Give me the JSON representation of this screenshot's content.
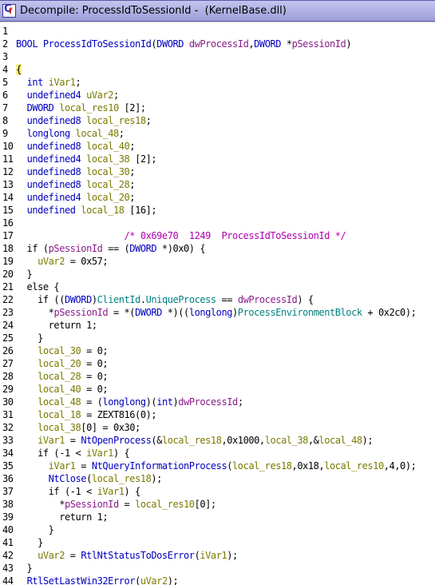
{
  "window": {
    "title": "Decompile: ProcessIdToSessionId -  (KernelBase.dll)"
  },
  "icon": {
    "letter": "C",
    "subscript": "f"
  },
  "colors": {
    "type": "#0000c0",
    "local_var": "#7a7a00",
    "parameter": "#8a1a8a",
    "function": "#0000c0",
    "field": "#008080",
    "comment": "#b000b0",
    "brace_highlight": "#f7f389",
    "titlebar": "#b0b0e4"
  },
  "code_lines": [
    {
      "n": "1",
      "tokens": []
    },
    {
      "n": "2",
      "tokens": [
        {
          "c": "t-type",
          "t": "BOOL"
        },
        {
          "c": "t-plain",
          "t": " "
        },
        {
          "c": "t-fn",
          "t": "ProcessIdToSessionId"
        },
        {
          "c": "t-plain",
          "t": "("
        },
        {
          "c": "t-type",
          "t": "DWORD"
        },
        {
          "c": "t-plain",
          "t": " "
        },
        {
          "c": "t-param",
          "t": "dwProcessId"
        },
        {
          "c": "t-plain",
          "t": ","
        },
        {
          "c": "t-type",
          "t": "DWORD"
        },
        {
          "c": "t-plain",
          "t": " *"
        },
        {
          "c": "t-param",
          "t": "pSessionId"
        },
        {
          "c": "t-plain",
          "t": ")"
        }
      ]
    },
    {
      "n": "3",
      "tokens": []
    },
    {
      "n": "4",
      "tokens": [
        {
          "c": "brace-hl",
          "t": "{"
        }
      ]
    },
    {
      "n": "5",
      "tokens": [
        {
          "c": "t-plain",
          "t": "  "
        },
        {
          "c": "t-type",
          "t": "int"
        },
        {
          "c": "t-plain",
          "t": " "
        },
        {
          "c": "t-var",
          "t": "iVar1"
        },
        {
          "c": "t-plain",
          "t": ";"
        }
      ]
    },
    {
      "n": "6",
      "tokens": [
        {
          "c": "t-plain",
          "t": "  "
        },
        {
          "c": "t-type",
          "t": "undefined4"
        },
        {
          "c": "t-plain",
          "t": " "
        },
        {
          "c": "t-var",
          "t": "uVar2"
        },
        {
          "c": "t-plain",
          "t": ";"
        }
      ]
    },
    {
      "n": "7",
      "tokens": [
        {
          "c": "t-plain",
          "t": "  "
        },
        {
          "c": "t-type",
          "t": "DWORD"
        },
        {
          "c": "t-plain",
          "t": " "
        },
        {
          "c": "t-var",
          "t": "local_res10"
        },
        {
          "c": "t-plain",
          "t": " [2];"
        }
      ]
    },
    {
      "n": "8",
      "tokens": [
        {
          "c": "t-plain",
          "t": "  "
        },
        {
          "c": "t-type",
          "t": "undefined8"
        },
        {
          "c": "t-plain",
          "t": " "
        },
        {
          "c": "t-var",
          "t": "local_res18"
        },
        {
          "c": "t-plain",
          "t": ";"
        }
      ]
    },
    {
      "n": "9",
      "tokens": [
        {
          "c": "t-plain",
          "t": "  "
        },
        {
          "c": "t-type",
          "t": "longlong"
        },
        {
          "c": "t-plain",
          "t": " "
        },
        {
          "c": "t-var",
          "t": "local_48"
        },
        {
          "c": "t-plain",
          "t": ";"
        }
      ]
    },
    {
      "n": "10",
      "tokens": [
        {
          "c": "t-plain",
          "t": "  "
        },
        {
          "c": "t-type",
          "t": "undefined8"
        },
        {
          "c": "t-plain",
          "t": " "
        },
        {
          "c": "t-var",
          "t": "local_40"
        },
        {
          "c": "t-plain",
          "t": ";"
        }
      ]
    },
    {
      "n": "11",
      "tokens": [
        {
          "c": "t-plain",
          "t": "  "
        },
        {
          "c": "t-type",
          "t": "undefined4"
        },
        {
          "c": "t-plain",
          "t": " "
        },
        {
          "c": "t-var",
          "t": "local_38"
        },
        {
          "c": "t-plain",
          "t": " [2];"
        }
      ]
    },
    {
      "n": "12",
      "tokens": [
        {
          "c": "t-plain",
          "t": "  "
        },
        {
          "c": "t-type",
          "t": "undefined8"
        },
        {
          "c": "t-plain",
          "t": " "
        },
        {
          "c": "t-var",
          "t": "local_30"
        },
        {
          "c": "t-plain",
          "t": ";"
        }
      ]
    },
    {
      "n": "13",
      "tokens": [
        {
          "c": "t-plain",
          "t": "  "
        },
        {
          "c": "t-type",
          "t": "undefined8"
        },
        {
          "c": "t-plain",
          "t": " "
        },
        {
          "c": "t-var",
          "t": "local_28"
        },
        {
          "c": "t-plain",
          "t": ";"
        }
      ]
    },
    {
      "n": "14",
      "tokens": [
        {
          "c": "t-plain",
          "t": "  "
        },
        {
          "c": "t-type",
          "t": "undefined4"
        },
        {
          "c": "t-plain",
          "t": " "
        },
        {
          "c": "t-var",
          "t": "local_20"
        },
        {
          "c": "t-plain",
          "t": ";"
        }
      ]
    },
    {
      "n": "15",
      "tokens": [
        {
          "c": "t-plain",
          "t": "  "
        },
        {
          "c": "t-type",
          "t": "undefined"
        },
        {
          "c": "t-plain",
          "t": " "
        },
        {
          "c": "t-var",
          "t": "local_18"
        },
        {
          "c": "t-plain",
          "t": " [16];"
        }
      ]
    },
    {
      "n": "16",
      "tokens": []
    },
    {
      "n": "17",
      "tokens": [
        {
          "c": "t-plain",
          "t": "                    "
        },
        {
          "c": "t-cmt",
          "t": "/* 0x69e70  1249  ProcessIdToSessionId */"
        }
      ]
    },
    {
      "n": "18",
      "tokens": [
        {
          "c": "t-plain",
          "t": "  if ("
        },
        {
          "c": "t-param",
          "t": "pSessionId"
        },
        {
          "c": "t-plain",
          "t": " == ("
        },
        {
          "c": "t-type",
          "t": "DWORD"
        },
        {
          "c": "t-plain",
          "t": " *)0x0) {"
        }
      ]
    },
    {
      "n": "19",
      "tokens": [
        {
          "c": "t-plain",
          "t": "    "
        },
        {
          "c": "t-var",
          "t": "uVar2"
        },
        {
          "c": "t-plain",
          "t": " = 0x57;"
        }
      ]
    },
    {
      "n": "20",
      "tokens": [
        {
          "c": "t-plain",
          "t": "  }"
        }
      ]
    },
    {
      "n": "21",
      "tokens": [
        {
          "c": "t-plain",
          "t": "  else {"
        }
      ]
    },
    {
      "n": "22",
      "tokens": [
        {
          "c": "t-plain",
          "t": "    if (("
        },
        {
          "c": "t-type",
          "t": "DWORD"
        },
        {
          "c": "t-plain",
          "t": ")"
        },
        {
          "c": "t-field",
          "t": "ClientId"
        },
        {
          "c": "t-plain",
          "t": "."
        },
        {
          "c": "t-field",
          "t": "UniqueProcess"
        },
        {
          "c": "t-plain",
          "t": " == "
        },
        {
          "c": "t-param",
          "t": "dwProcessId"
        },
        {
          "c": "t-plain",
          "t": ") {"
        }
      ]
    },
    {
      "n": "23",
      "tokens": [
        {
          "c": "t-plain",
          "t": "      *"
        },
        {
          "c": "t-param",
          "t": "pSessionId"
        },
        {
          "c": "t-plain",
          "t": " = *("
        },
        {
          "c": "t-type",
          "t": "DWORD"
        },
        {
          "c": "t-plain",
          "t": " *)(("
        },
        {
          "c": "t-type",
          "t": "longlong"
        },
        {
          "c": "t-plain",
          "t": ")"
        },
        {
          "c": "t-field",
          "t": "ProcessEnvironmentBlock"
        },
        {
          "c": "t-plain",
          "t": " + 0x2c0);"
        }
      ]
    },
    {
      "n": "24",
      "tokens": [
        {
          "c": "t-plain",
          "t": "      return 1;"
        }
      ]
    },
    {
      "n": "25",
      "tokens": [
        {
          "c": "t-plain",
          "t": "    }"
        }
      ]
    },
    {
      "n": "26",
      "tokens": [
        {
          "c": "t-plain",
          "t": "    "
        },
        {
          "c": "t-var",
          "t": "local_30"
        },
        {
          "c": "t-plain",
          "t": " = 0;"
        }
      ]
    },
    {
      "n": "27",
      "tokens": [
        {
          "c": "t-plain",
          "t": "    "
        },
        {
          "c": "t-var",
          "t": "local_20"
        },
        {
          "c": "t-plain",
          "t": " = 0;"
        }
      ]
    },
    {
      "n": "28",
      "tokens": [
        {
          "c": "t-plain",
          "t": "    "
        },
        {
          "c": "t-var",
          "t": "local_28"
        },
        {
          "c": "t-plain",
          "t": " = 0;"
        }
      ]
    },
    {
      "n": "29",
      "tokens": [
        {
          "c": "t-plain",
          "t": "    "
        },
        {
          "c": "t-var",
          "t": "local_40"
        },
        {
          "c": "t-plain",
          "t": " = 0;"
        }
      ]
    },
    {
      "n": "30",
      "tokens": [
        {
          "c": "t-plain",
          "t": "    "
        },
        {
          "c": "t-var",
          "t": "local_48"
        },
        {
          "c": "t-plain",
          "t": " = ("
        },
        {
          "c": "t-type",
          "t": "longlong"
        },
        {
          "c": "t-plain",
          "t": ")("
        },
        {
          "c": "t-type",
          "t": "int"
        },
        {
          "c": "t-plain",
          "t": ")"
        },
        {
          "c": "t-param",
          "t": "dwProcessId"
        },
        {
          "c": "t-plain",
          "t": ";"
        }
      ]
    },
    {
      "n": "31",
      "tokens": [
        {
          "c": "t-plain",
          "t": "    "
        },
        {
          "c": "t-var",
          "t": "local_18"
        },
        {
          "c": "t-plain",
          "t": " = ZEXT816(0);"
        }
      ]
    },
    {
      "n": "32",
      "tokens": [
        {
          "c": "t-plain",
          "t": "    "
        },
        {
          "c": "t-var",
          "t": "local_38"
        },
        {
          "c": "t-plain",
          "t": "[0] = 0x30;"
        }
      ]
    },
    {
      "n": "33",
      "tokens": [
        {
          "c": "t-plain",
          "t": "    "
        },
        {
          "c": "t-var",
          "t": "iVar1"
        },
        {
          "c": "t-plain",
          "t": " = "
        },
        {
          "c": "t-fn",
          "t": "NtOpenProcess"
        },
        {
          "c": "t-plain",
          "t": "(&"
        },
        {
          "c": "t-var",
          "t": "local_res18"
        },
        {
          "c": "t-plain",
          "t": ",0x1000,"
        },
        {
          "c": "t-var",
          "t": "local_38"
        },
        {
          "c": "t-plain",
          "t": ",&"
        },
        {
          "c": "t-var",
          "t": "local_48"
        },
        {
          "c": "t-plain",
          "t": ");"
        }
      ]
    },
    {
      "n": "34",
      "tokens": [
        {
          "c": "t-plain",
          "t": "    if (-1 < "
        },
        {
          "c": "t-var",
          "t": "iVar1"
        },
        {
          "c": "t-plain",
          "t": ") {"
        }
      ]
    },
    {
      "n": "35",
      "tokens": [
        {
          "c": "t-plain",
          "t": "      "
        },
        {
          "c": "t-var",
          "t": "iVar1"
        },
        {
          "c": "t-plain",
          "t": " = "
        },
        {
          "c": "t-fn",
          "t": "NtQueryInformationProcess"
        },
        {
          "c": "t-plain",
          "t": "("
        },
        {
          "c": "t-var",
          "t": "local_res18"
        },
        {
          "c": "t-plain",
          "t": ",0x18,"
        },
        {
          "c": "t-var",
          "t": "local_res10"
        },
        {
          "c": "t-plain",
          "t": ",4,0);"
        }
      ]
    },
    {
      "n": "36",
      "tokens": [
        {
          "c": "t-plain",
          "t": "      "
        },
        {
          "c": "t-fn",
          "t": "NtClose"
        },
        {
          "c": "t-plain",
          "t": "("
        },
        {
          "c": "t-var",
          "t": "local_res18"
        },
        {
          "c": "t-plain",
          "t": ");"
        }
      ]
    },
    {
      "n": "37",
      "tokens": [
        {
          "c": "t-plain",
          "t": "      if (-1 < "
        },
        {
          "c": "t-var",
          "t": "iVar1"
        },
        {
          "c": "t-plain",
          "t": ") {"
        }
      ]
    },
    {
      "n": "38",
      "tokens": [
        {
          "c": "t-plain",
          "t": "        *"
        },
        {
          "c": "t-param",
          "t": "pSessionId"
        },
        {
          "c": "t-plain",
          "t": " = "
        },
        {
          "c": "t-var",
          "t": "local_res10"
        },
        {
          "c": "t-plain",
          "t": "[0];"
        }
      ]
    },
    {
      "n": "39",
      "tokens": [
        {
          "c": "t-plain",
          "t": "        return 1;"
        }
      ]
    },
    {
      "n": "40",
      "tokens": [
        {
          "c": "t-plain",
          "t": "      }"
        }
      ]
    },
    {
      "n": "41",
      "tokens": [
        {
          "c": "t-plain",
          "t": "    }"
        }
      ]
    },
    {
      "n": "42",
      "tokens": [
        {
          "c": "t-plain",
          "t": "    "
        },
        {
          "c": "t-var",
          "t": "uVar2"
        },
        {
          "c": "t-plain",
          "t": " = "
        },
        {
          "c": "t-fn",
          "t": "RtlNtStatusToDosError"
        },
        {
          "c": "t-plain",
          "t": "("
        },
        {
          "c": "t-var",
          "t": "iVar1"
        },
        {
          "c": "t-plain",
          "t": ");"
        }
      ]
    },
    {
      "n": "43",
      "tokens": [
        {
          "c": "t-plain",
          "t": "  }"
        }
      ]
    },
    {
      "n": "44",
      "tokens": [
        {
          "c": "t-plain",
          "t": "  "
        },
        {
          "c": "t-fn",
          "t": "RtlSetLastWin32Error"
        },
        {
          "c": "t-plain",
          "t": "("
        },
        {
          "c": "t-var",
          "t": "uVar2"
        },
        {
          "c": "t-plain",
          "t": ");"
        }
      ]
    }
  ]
}
